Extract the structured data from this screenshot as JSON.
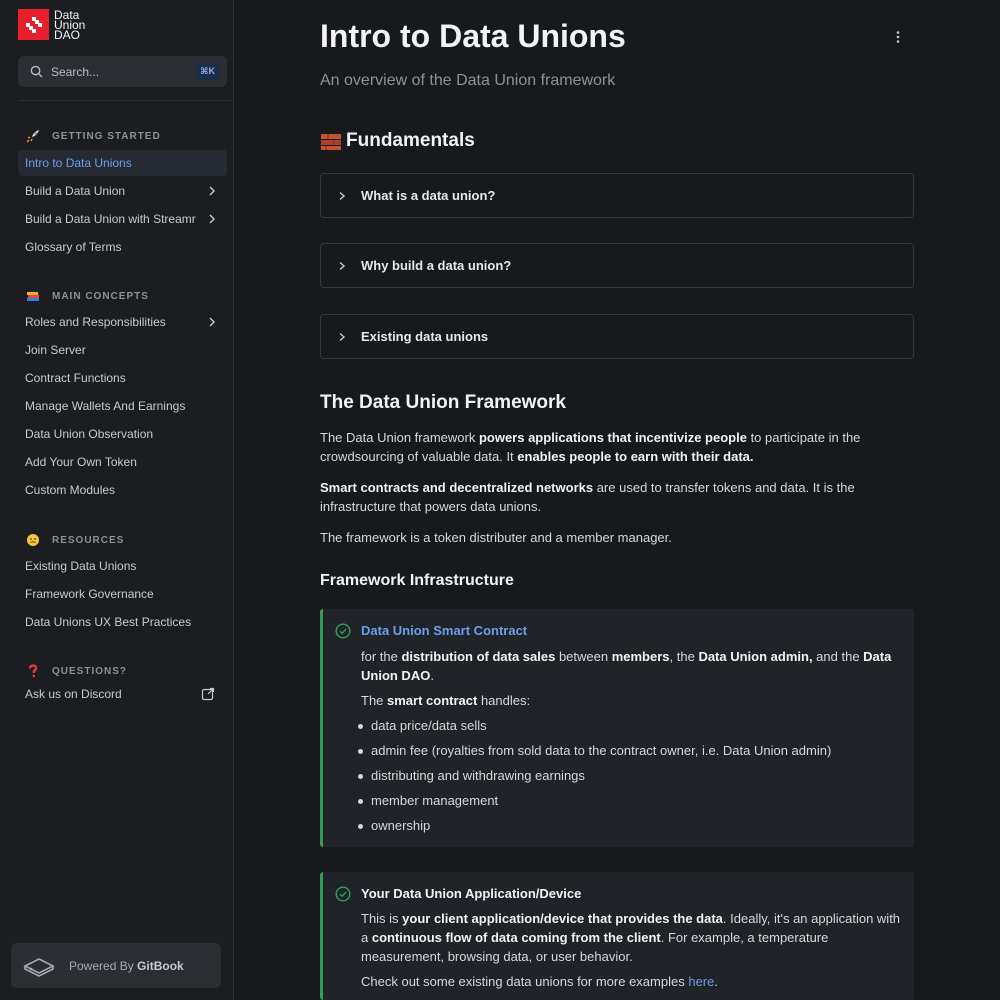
{
  "sidebar": {
    "logo": {
      "line1": "Data",
      "line2": "Union",
      "line3": "DAO"
    },
    "search": {
      "placeholder": "Search...",
      "shortcut": "⌘K"
    },
    "sections": [
      {
        "emoji": "rocket",
        "title": "GETTING STARTED"
      },
      {
        "emoji": "books",
        "title": "MAIN CONCEPTS"
      },
      {
        "emoji": "face",
        "title": "RESOURCES"
      },
      {
        "emoji": "question",
        "title": "QUESTIONS?"
      }
    ],
    "items": [
      "Intro to Data Unions",
      "Build a Data Union",
      "Build a Data Union with Streamr",
      "Glossary of Terms",
      "Roles and Responsibilities",
      "Join Server",
      "Contract Functions",
      "Manage Wallets And Earnings",
      "Data Union Observation",
      "Add Your Own Token",
      "Custom Modules",
      "Existing Data Unions",
      "Framework Governance",
      "Data Unions UX Best Practices",
      "Ask us on Discord"
    ],
    "powered_prefix": "Powered By",
    "powered_brand": "GitBook"
  },
  "page": {
    "title": "Intro to Data Unions",
    "subtitle": "An overview of the Data Union framework",
    "fundamentals_heading": "Fundamentals",
    "accordions": [
      "What is a data union?",
      "Why build a data union?",
      "Existing data unions"
    ],
    "framework_heading": "The Data Union Framework",
    "p1": {
      "a": "The Data Union framework ",
      "b": "powers applications that incentivize people",
      "c": " to participate in the crowdsourcing of valuable data. It ",
      "d": "enables people to earn with their data."
    },
    "p2": {
      "a": "Smart contracts and decentralized networks",
      "b": " are used to transfer tokens and data. It is the infrastructure that powers data unions."
    },
    "p3": "The framework is a token distributer and a member manager.",
    "infra_heading": "Framework Infrastructure",
    "hint1": {
      "title": "Data Union Smart Contract",
      "l1": "for the ",
      "l2": "distribution of data sales",
      "l3": " between ",
      "l4": "members",
      "l5": ", the ",
      "l6": "Data Union admin,",
      "l7": " and the ",
      "l8": "Data Union DAO",
      "l9": ".",
      "h1": "The ",
      "h2": "smart contract",
      "h3": " handles:",
      "bullets": [
        "data price/data sells",
        "admin fee (royalties from sold data to the contract owner, i.e. Data Union admin)",
        "distributing and withdrawing earnings",
        "member management",
        "ownership"
      ]
    },
    "hint2": {
      "title": "Your Data Union Application/Device",
      "a": "This is ",
      "b": "your client application/device that provides the data",
      "c": ". Ideally, it's an application with a ",
      "d": "continuous flow of data coming from the client",
      "e": ". For example, a temperature measurement, browsing data, or user behavior.",
      "f": "Check out some existing data unions for more examples ",
      "g": "here",
      "h": "."
    }
  },
  "colors": {
    "accent": "#6f9ee8",
    "success": "#2f9e5d",
    "brand": "#e8202e"
  }
}
